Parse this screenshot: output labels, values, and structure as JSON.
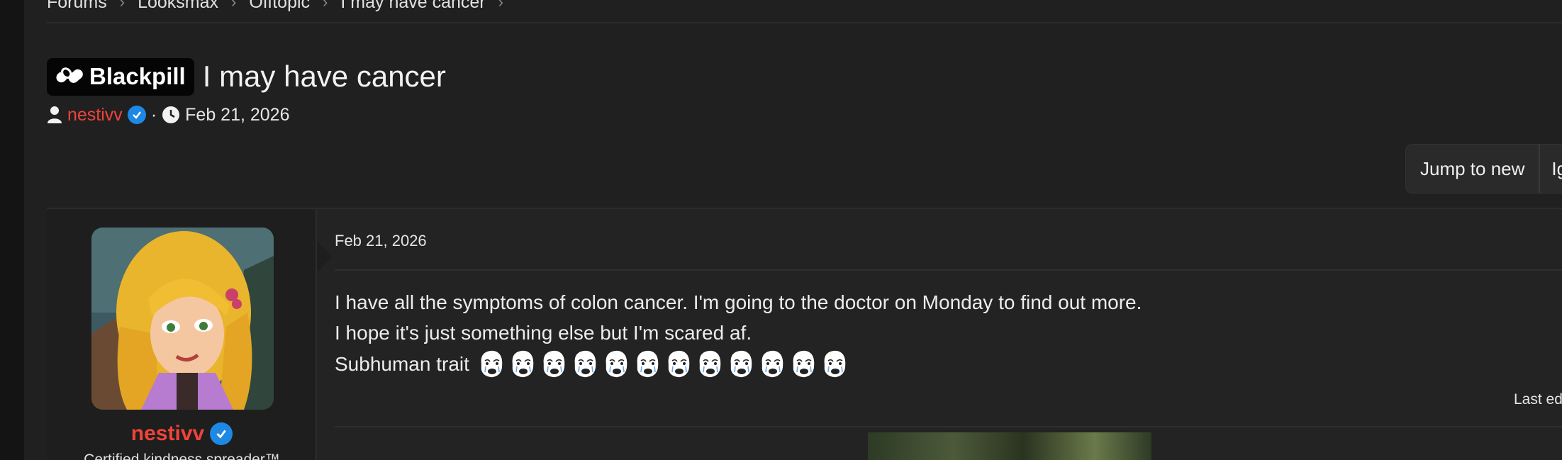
{
  "breadcrumb": {
    "items": [
      "Forums",
      "Looksmax",
      "Offtopic",
      "I may have cancer"
    ]
  },
  "thread": {
    "prefix": "Blackpill",
    "title": "I may have cancer",
    "author": "nestivv",
    "separator": "·",
    "date": "Feb 21, 2026"
  },
  "actions": {
    "jump_to_new": "Jump to new",
    "ignore": "Ig"
  },
  "post": {
    "date": "Feb 21, 2026",
    "lines": [
      "I have all the symptoms of colon cancer. I'm going to the doctor on Monday to find out more.",
      "I hope it's just something else but I'm scared af.",
      "Subhuman trait"
    ],
    "emoji_count": 12,
    "emoji_name": "crying-wojak-icon",
    "last_edited": "Last ed"
  },
  "user": {
    "name": "nestivv",
    "title": "Certified kindness spreader™"
  },
  "colors": {
    "accent_username": "#f0433a",
    "verified_blue": "#1e88e5",
    "background": "#202020"
  }
}
